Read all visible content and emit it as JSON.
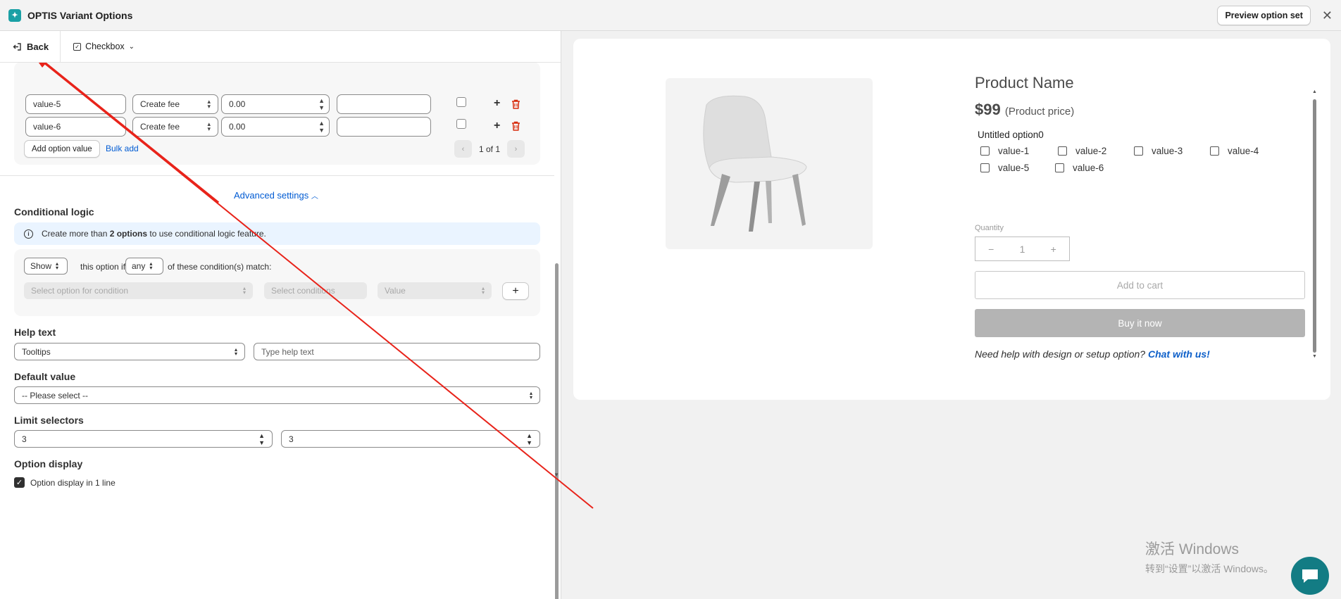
{
  "app": {
    "title": "OPTIS Variant Options",
    "preview_button": "Preview option set",
    "close_glyph": "✕"
  },
  "toolbar": {
    "back_label": "Back",
    "option_type": "Checkbox"
  },
  "values_table": {
    "rows": [
      {
        "value": "value-5",
        "fee_type": "Create fee",
        "price": "0.00",
        "text": ""
      },
      {
        "value": "value-6",
        "fee_type": "Create fee",
        "price": "0.00",
        "text": ""
      }
    ],
    "add_value_label": "Add option value",
    "bulk_add_label": "Bulk add",
    "pagination": "1 of 1"
  },
  "advanced": {
    "label": "Advanced settings"
  },
  "conditional_logic": {
    "title": "Conditional logic",
    "banner_prefix": "Create more than ",
    "banner_bold": "2 options",
    "banner_suffix": " to use conditional logic feature.",
    "show_value": "Show",
    "text1": "this option if",
    "any_value": "any",
    "text2": "of these condition(s) match:",
    "option_placeholder": "Select option for condition",
    "conditions_placeholder": "Select conditions",
    "value_placeholder": "Value",
    "add_glyph": "+"
  },
  "help_text": {
    "title": "Help text",
    "type_value": "Tooltips",
    "placeholder": "Type help text"
  },
  "default_value": {
    "title": "Default value",
    "value": "-- Please select --"
  },
  "limit_selectors": {
    "title": "Limit selectors",
    "min": "3",
    "max": "3"
  },
  "option_display": {
    "title": "Option display",
    "checkbox_label": "Option display in 1 line",
    "checked": true
  },
  "preview": {
    "product_name": "Product Name",
    "price": "$99",
    "price_note": "(Product price)",
    "option_name": "Untitled option0",
    "values": [
      "value-1",
      "value-2",
      "value-3",
      "value-4",
      "value-5",
      "value-6"
    ],
    "quantity_label": "Quantity",
    "quantity": "1",
    "minus": "−",
    "plus": "+",
    "add_to_cart": "Add to cart",
    "buy_now": "Buy it now",
    "help_prefix": "Need help with design or setup option? ",
    "help_link": "Chat with us!"
  },
  "watermark": {
    "line1": "激活 Windows",
    "line2": "转到“设置”以激活 Windows。"
  },
  "colors": {
    "accent": "#005bd3",
    "teal": "#137c84",
    "annotation_red": "#e8231a",
    "banner_bg": "#eaf4ff"
  }
}
